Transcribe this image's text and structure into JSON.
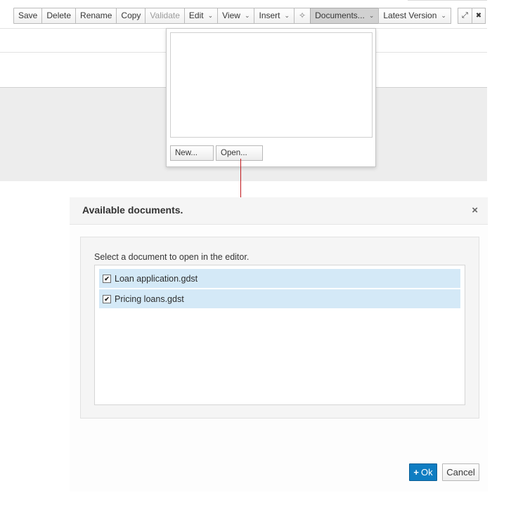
{
  "toolbar": {
    "save": "Save",
    "delete": "Delete",
    "rename": "Rename",
    "copy": "Copy",
    "validate": "Validate",
    "edit": "Edit",
    "view": "View",
    "insert": "Insert",
    "documents": "Documents...",
    "latest_version": "Latest Version",
    "caret": "⌄",
    "target_icon": "✧",
    "expand_icon": "⤢",
    "close_icon": "✖"
  },
  "documents_menu": {
    "new_label": "New...",
    "open_label": "Open..."
  },
  "modal": {
    "title": "Available documents.",
    "close": "×",
    "instruction": "Select a document to open in the editor.",
    "documents": [
      {
        "name": "Loan application.gdst",
        "checked": true
      },
      {
        "name": "Pricing loans.gdst",
        "checked": true
      }
    ],
    "ok_label": "Ok",
    "ok_icon": "+",
    "cancel_label": "Cancel"
  },
  "colors": {
    "primary": "#0f7dc2",
    "selection": "#d4e9f7",
    "arrow": "#c0171b"
  }
}
